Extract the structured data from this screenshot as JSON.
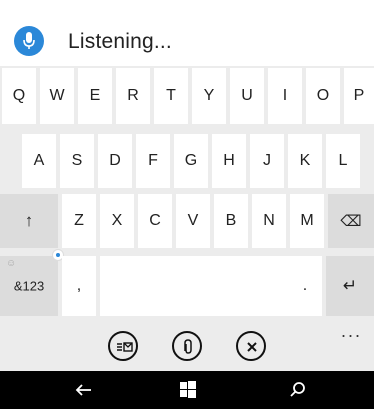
{
  "dictation": {
    "status": "Listening...",
    "mic_color": "#2b88d8"
  },
  "keyboard": {
    "row1": [
      "Q",
      "W",
      "E",
      "R",
      "T",
      "Y",
      "U",
      "I",
      "O",
      "P"
    ],
    "row2": [
      "A",
      "S",
      "D",
      "F",
      "G",
      "H",
      "J",
      "K",
      "L"
    ],
    "row3": [
      "Z",
      "X",
      "C",
      "V",
      "B",
      "N",
      "M"
    ],
    "shift_symbol": "↑",
    "backspace_symbol": "⌫",
    "numbers_label": "&123",
    "comma_label": ",",
    "period_label": ".",
    "enter_symbol": "↵",
    "emoji_symbol": "☺"
  },
  "actions": {
    "more_label": "..."
  },
  "icons": {
    "mic": "microphone-icon",
    "shift": "shift-arrow-icon",
    "backspace": "backspace-icon",
    "enter": "enter-icon",
    "emoji": "emoji-icon",
    "keyboard_switch": "keyboard-layout-icon",
    "attach": "paperclip-icon",
    "close": "close-icon",
    "back": "back-arrow-icon",
    "start": "windows-start-icon",
    "search": "search-icon"
  }
}
